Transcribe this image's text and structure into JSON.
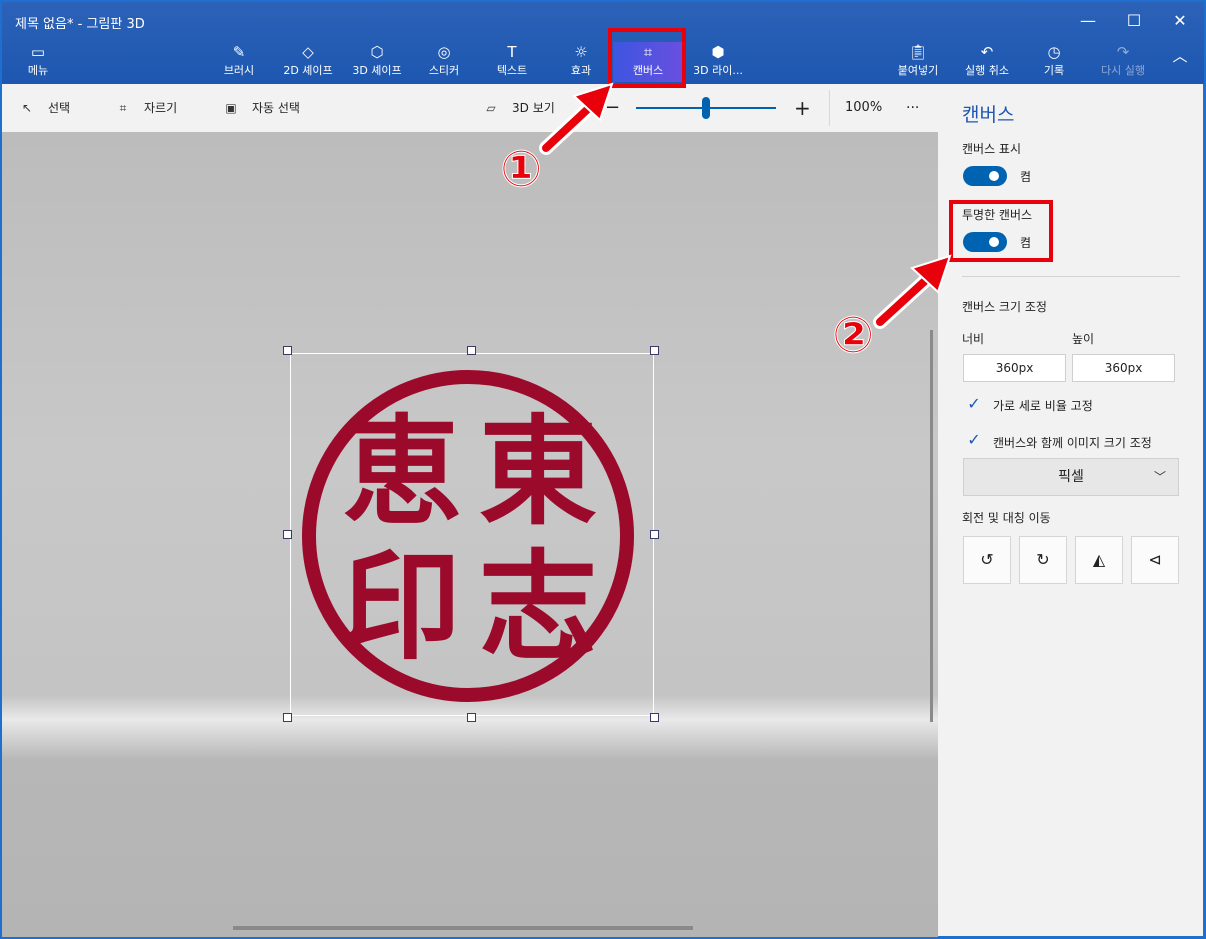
{
  "window": {
    "title": "제목 없음* - 그림판 3D",
    "minimize": "—",
    "maximize": "☐",
    "close": "✕"
  },
  "toolbar": {
    "menu": "메뉴",
    "brush": "브러시",
    "shapes_2d": "2D 셰이프",
    "shapes_3d": "3D 셰이프",
    "sticker": "스티커",
    "text": "텍스트",
    "effects": "효과",
    "canvas": "캔버스",
    "library_3d": "3D 라이...",
    "paste": "붙여넣기",
    "undo": "실행 취소",
    "history": "기록",
    "redo": "다시 실행"
  },
  "subbar": {
    "select": "선택",
    "crop": "자르기",
    "magic_select": "자동 선택",
    "view_3d": "3D 보기",
    "zoom_minus": "−",
    "zoom_plus": "+",
    "zoom_level": "100%",
    "more": "···",
    "zoom_value": 0.5
  },
  "panel": {
    "title": "캔버스",
    "show_canvas_label": "캔버스 표시",
    "show_canvas_state": "켬",
    "transparent_label": "투명한 캔버스",
    "transparent_state": "켬",
    "resize_label": "캔버스 크기 조정",
    "width_label": "너비",
    "height_label": "높이",
    "width_value": "360px",
    "height_value": "360px",
    "lock_ratio_label": "가로 세로 비율 고정",
    "resize_image_label": "캔버스와 함께 이미지 크기 조정",
    "unit_value": "픽셀",
    "rotate_label": "회전 및 대칭 이동"
  },
  "stamp": {
    "chars": [
      "東",
      "恵",
      "志",
      "印"
    ]
  },
  "annotations": {
    "one": "①",
    "two": "②"
  },
  "colors": {
    "accent": "#1d57b0",
    "toggle": "#0063b1",
    "stamp": "#9b0a2a",
    "annotation": "#e8000b"
  }
}
